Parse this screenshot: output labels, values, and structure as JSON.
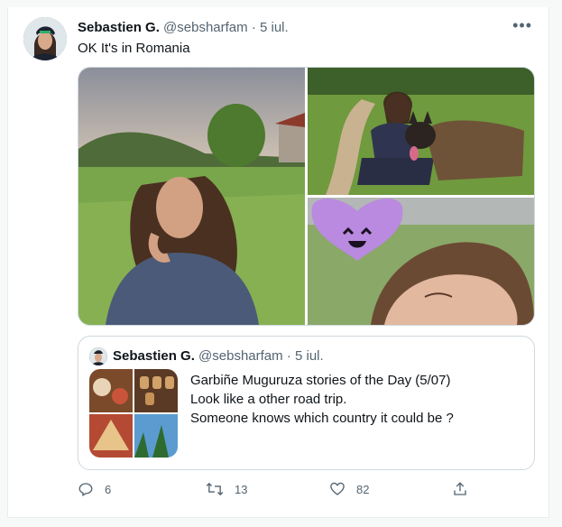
{
  "tweet": {
    "author_name": "Sebastien G.",
    "handle": "@sebsharfam",
    "separator": "·",
    "date": "5 iul.",
    "more_label": "•••",
    "text": "OK It's in Romania"
  },
  "quoted_tweet": {
    "author_name": "Sebastien G.",
    "handle": "@sebsharfam",
    "separator": "·",
    "date": "5 iul.",
    "lines": [
      "Garbiñe Muguruza stories of the Day (5/07)",
      "Look like a other road trip.",
      "Someone knows which country it could be ?"
    ]
  },
  "actions": {
    "reply_count": "6",
    "retweet_count": "13",
    "like_count": "82"
  },
  "icons": {
    "reply": "reply-icon",
    "retweet": "retweet-icon",
    "like": "heart-icon",
    "share": "share-icon",
    "more": "more-icon"
  },
  "colors": {
    "text_primary": "#0f1419",
    "text_secondary": "#536471",
    "border": "#cfd9de"
  }
}
